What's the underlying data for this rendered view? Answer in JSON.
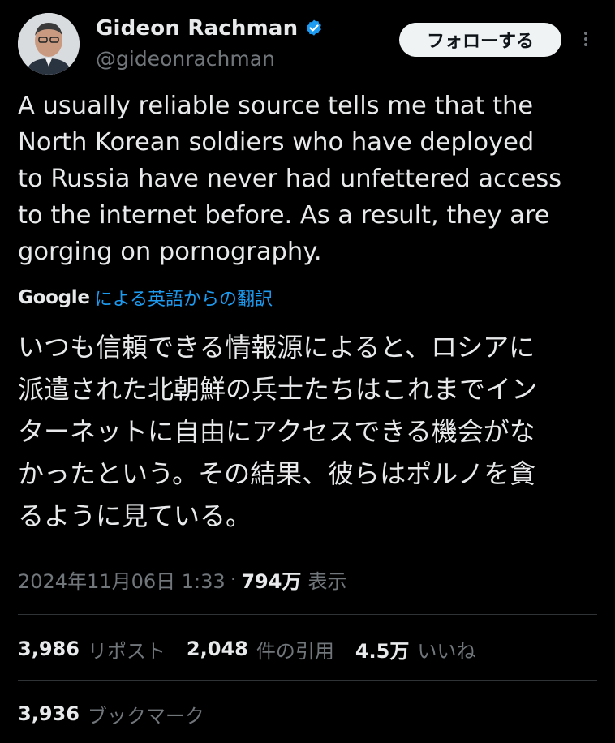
{
  "author": {
    "display_name": "Gideon Rachman",
    "handle": "@gideonrachman",
    "verified_icon": "verified-badge-icon",
    "badge_color": "#1d9bf0"
  },
  "follow_button": {
    "label": "フォローする"
  },
  "more_icon": "more-vertical-icon",
  "tweet": {
    "text": "A usually reliable source tells me that the\nNorth Korean soldiers who have deployed\nto Russia have never had unfettered access\nto the internet before. As a result, they are\ngorging on pornography.",
    "translation_provider": "Google",
    "translation_link": "による英語からの翻訳",
    "translated_text": "いつも信頼できる情報源によると、ロシアに\n派遣された北朝鮮の兵士たちはこれまでイン\nターネットに自由にアクセスできる機会がな\nかったという。その結果、彼らはポルノを貪\nるように見ている。"
  },
  "meta": {
    "timestamp": "2024年11月06日 1:33",
    "separator": "·",
    "views_count": "794万",
    "views_label": "表示"
  },
  "stats": {
    "reposts_count": "3,986",
    "reposts_label": "リポスト",
    "quotes_count": "2,048",
    "quotes_label": "件の引用",
    "likes_count": "4.5万",
    "likes_label": "いいね",
    "bookmarks_count": "3,936",
    "bookmarks_label": "ブックマーク"
  },
  "colors": {
    "background": "#000000",
    "text": "#e7e9ea",
    "muted": "#71767b",
    "link": "#1d9bf0",
    "divider": "#2f3336"
  }
}
